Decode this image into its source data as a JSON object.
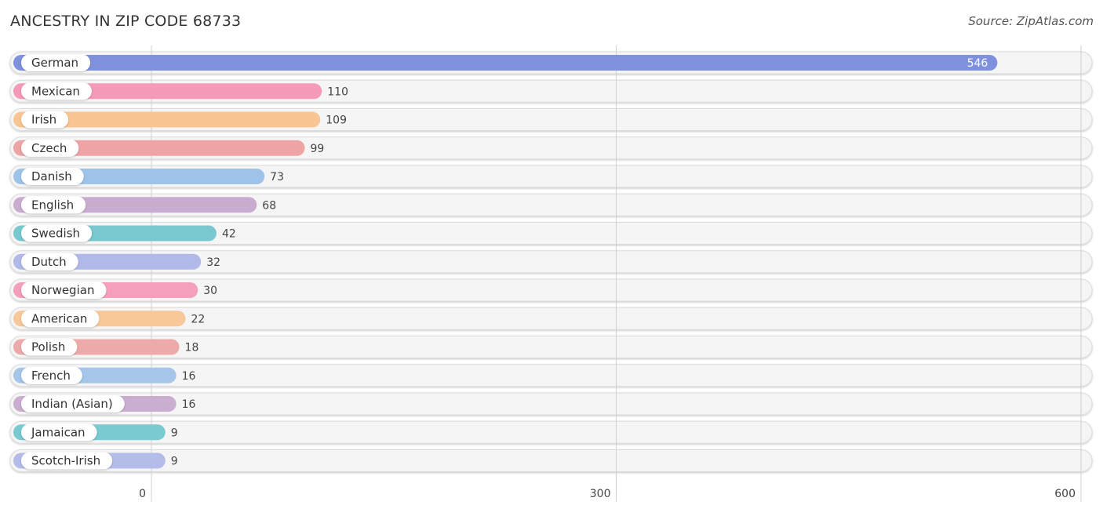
{
  "header": {
    "title": "ANCESTRY IN ZIP CODE 68733",
    "source": "Source: ZipAtlas.com"
  },
  "chart_data": {
    "type": "bar",
    "orientation": "horizontal",
    "title": "ANCESTRY IN ZIP CODE 68733",
    "xlabel": "",
    "ylabel": "",
    "xlim": [
      0,
      600
    ],
    "xticks": [
      0,
      300,
      600
    ],
    "grid": true,
    "legend": "none",
    "categories": [
      "German",
      "Mexican",
      "Irish",
      "Czech",
      "Danish",
      "English",
      "Swedish",
      "Dutch",
      "Norwegian",
      "American",
      "Polish",
      "French",
      "Indian (Asian)",
      "Jamaican",
      "Scotch-Irish"
    ],
    "values": [
      546,
      110,
      109,
      99,
      73,
      68,
      42,
      32,
      30,
      22,
      18,
      16,
      16,
      9,
      9
    ],
    "colors": [
      "#7f91dc",
      "#f59ab8",
      "#f9c592",
      "#eea3a4",
      "#9fc2e8",
      "#c9acd0",
      "#79c8cf",
      "#b1b9e9",
      "#f4a0bd",
      "#f8c89b",
      "#eeaaab",
      "#a5c6e9",
      "#c9aed1",
      "#79cad1",
      "#b4bdea"
    ]
  }
}
